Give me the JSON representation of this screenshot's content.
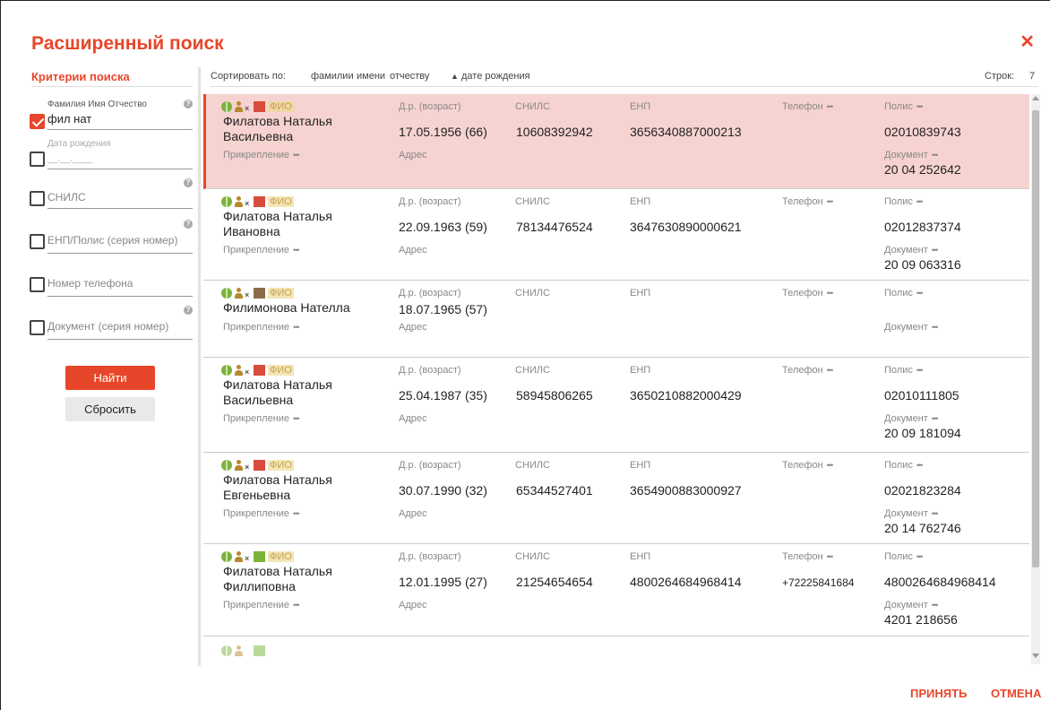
{
  "dialog": {
    "title": "Расширенный поиск",
    "close_icon": "close-icon",
    "accept_label": "ПРИНЯТЬ",
    "cancel_label": "ОТМЕНА"
  },
  "criteria": {
    "title": "Критерии поиска",
    "fio": {
      "label": "Фамилия Имя Отчество",
      "value": "фил нат",
      "checked": true
    },
    "birth_date": {
      "label": "Дата рождения",
      "placeholder": "__.__.____",
      "checked": false
    },
    "snils": {
      "placeholder": "СНИЛС",
      "checked": false
    },
    "enp": {
      "placeholder": "ЕНП/Полис (серия номер)",
      "checked": false
    },
    "phone": {
      "placeholder": "Номер телефона",
      "checked": false
    },
    "document": {
      "placeholder": "Документ (серия номер)",
      "checked": false
    },
    "find_label": "Найти",
    "reset_label": "Сбросить"
  },
  "sort": {
    "label": "Сортировать по:",
    "options": [
      "фамилии",
      "имени",
      "отчеству",
      "дате рождения"
    ],
    "active_arrow": "▲",
    "rows_label": "Строк:",
    "rows_count": "7"
  },
  "labels": {
    "fio": "ФИО",
    "birth": "Д.р. (возраст)",
    "snils": "СНИЛС",
    "enp": "ЕНП",
    "phone": "Телефон",
    "policy": "Полис",
    "attachment": "Прикрепление",
    "address": "Адрес",
    "document": "Документ",
    "dots": "•••"
  },
  "results": [
    {
      "name": "Филатова Наталья Васильевна",
      "birth": "17.05.1956 (66)",
      "snils": "10608392942",
      "enp": "3656340887000213",
      "phone": "",
      "policy": "02010839743",
      "document": "20 04 252642",
      "flag": "red",
      "selected": true
    },
    {
      "name": "Филатова Наталья Ивановна",
      "birth": "22.09.1963 (59)",
      "snils": "78134476524",
      "enp": "3647630890000621",
      "phone": "",
      "policy": "02012837374",
      "document": "20 09 063316",
      "flag": "red",
      "selected": false
    },
    {
      "name": "Филимонова Нателла",
      "birth": "18.07.1965 (57)",
      "snils": "",
      "enp": "",
      "phone": "",
      "policy": "",
      "document": "",
      "flag": "brown",
      "selected": false
    },
    {
      "name": "Филатова Наталья Васильевна",
      "birth": "25.04.1987 (35)",
      "snils": "58945806265",
      "enp": "3650210882000429",
      "phone": "",
      "policy": "02010111805",
      "document": "20 09 181094",
      "flag": "red",
      "selected": false
    },
    {
      "name": "Филатова Наталья Евгеньевна",
      "birth": "30.07.1990 (32)",
      "snils": "65344527401",
      "enp": "3654900883000927",
      "phone": "",
      "policy": "02021823284",
      "document": "20 14 762746",
      "flag": "red",
      "selected": false
    },
    {
      "name": "Филатова Наталья Филлиповна",
      "birth": "12.01.1995 (27)",
      "snils": "21254654654",
      "enp": "4800264684968414",
      "phone": "+72225841684",
      "policy": "4800264684968414",
      "document": "4201 218656",
      "flag": "green",
      "selected": false
    }
  ],
  "colors": {
    "accent": "#e8462a",
    "selected_row": "#f6d3d0"
  }
}
